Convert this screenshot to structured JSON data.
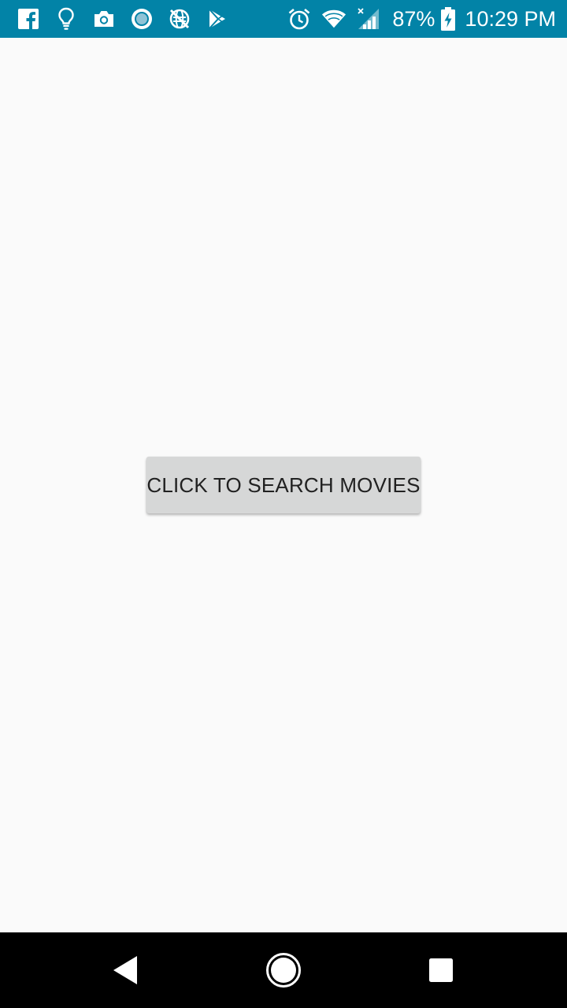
{
  "status_bar": {
    "battery_percent": "87%",
    "time": "10:29 PM",
    "background_color": "#0283A7",
    "notification_icons": [
      "facebook-icon",
      "lightbulb-icon",
      "camera-icon",
      "circle-app-icon",
      "sync-disabled-icon",
      "play-store-icon"
    ],
    "system_icons": [
      "alarm-icon",
      "wifi-icon",
      "cellular-signal-icon",
      "battery-charging-icon"
    ]
  },
  "main": {
    "search_button_label": "CLICK TO SEARCH MOVIES",
    "button_background": "#D6D7D7",
    "page_background": "#FAFAFA"
  },
  "nav_bar": {
    "buttons": [
      "back-icon",
      "home-icon",
      "recents-icon"
    ]
  }
}
